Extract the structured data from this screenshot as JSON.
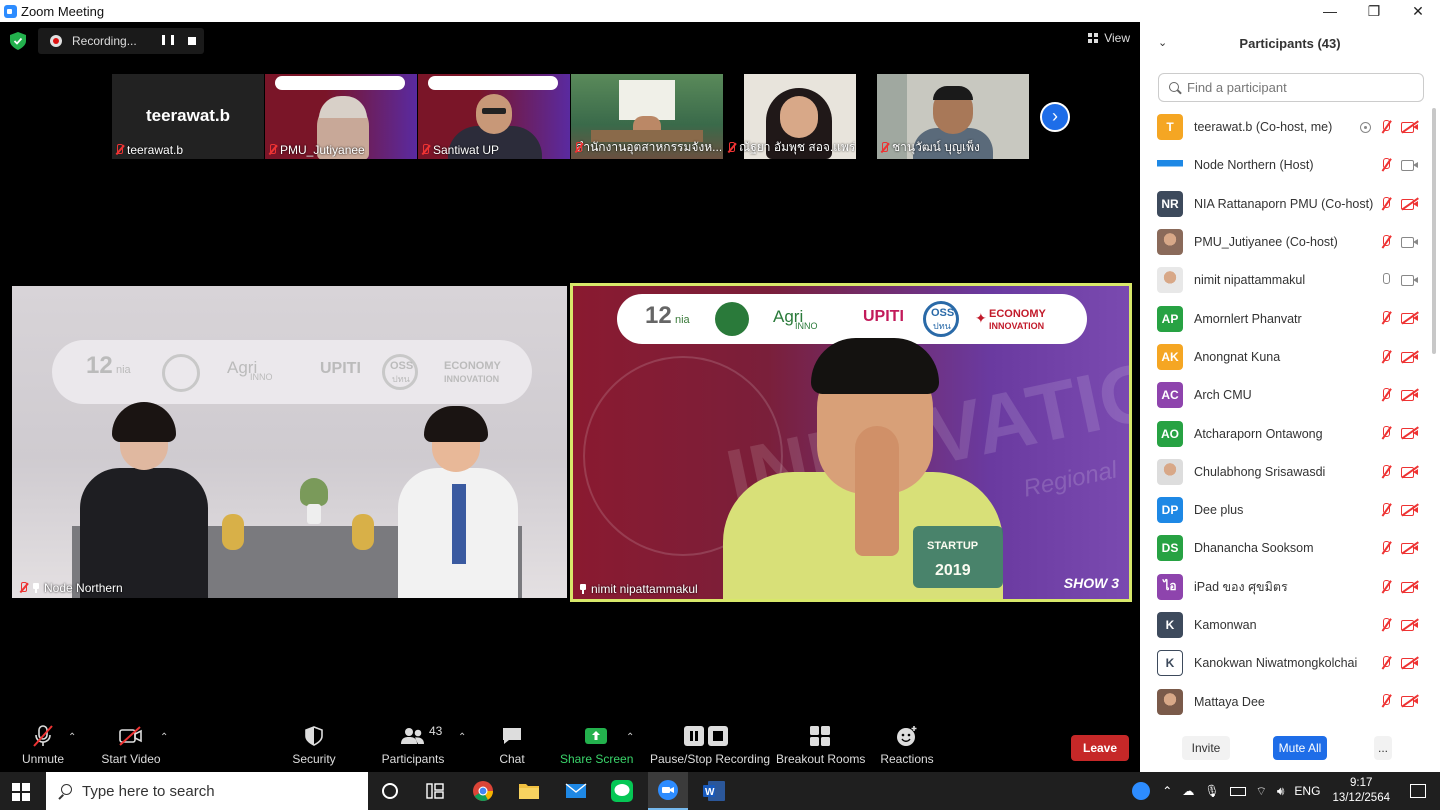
{
  "window": {
    "title": "Zoom Meeting",
    "controls": {
      "minimize": "—",
      "restore": "❐",
      "close": "✕"
    }
  },
  "topbar": {
    "recording_label": "Recording...",
    "view_label": "View"
  },
  "thumbnails": [
    {
      "name": "teerawat.b",
      "display_text": "teerawat.b",
      "muted": true,
      "has_video": false
    },
    {
      "name": "PMU_Jutiyanee",
      "muted": true,
      "has_video": true
    },
    {
      "name": "Santiwat UP",
      "muted": true,
      "has_video": true
    },
    {
      "name": "สำนักงานอุตสาหกรรมจังห...",
      "muted": true,
      "has_video": true
    },
    {
      "name": "ณัฐยา อัมพุช สอจ.แพร่",
      "muted": true,
      "has_video": true
    },
    {
      "name": "ชานุวัฒน์ บุญเพ็ง",
      "muted": true,
      "has_video": true
    }
  ],
  "main_videos": [
    {
      "name": "Node Northern",
      "muted": true,
      "pinned": true
    },
    {
      "name": "nimit nipattammakul",
      "muted": false,
      "pinned": true,
      "active_speaker": true
    }
  ],
  "video_banner_text": {
    "logo_12": "12",
    "nia": "nia",
    "agri": "Agri",
    "inno": "INNO",
    "upiti": "UPITI",
    "oss": "OSS",
    "oss_sub": "ปทน",
    "economy": "ECONOMY",
    "innovation": "INNOVATION",
    "show": "SHOW 3",
    "bg_word": "INNOVATION",
    "regional": "Regional",
    "shirt": "STARTUP",
    "shirt_year": "2019"
  },
  "toolbar": {
    "unmute": "Unmute",
    "start_video": "Start Video",
    "security": "Security",
    "participants": "Participants",
    "participants_count": "43",
    "chat": "Chat",
    "share_screen": "Share Screen",
    "pause_stop_recording": "Pause/Stop Recording",
    "breakout_rooms": "Breakout Rooms",
    "reactions": "Reactions",
    "leave": "Leave"
  },
  "panel": {
    "title": "Participants (43)",
    "search_placeholder": "Find a participant",
    "participants": [
      {
        "initials": "T",
        "color": "#f5a623",
        "name": "teerawat.b (Co-host, me)",
        "mic": "off",
        "cam": "off",
        "recording": true
      },
      {
        "initials": "",
        "color": "#ffffff",
        "name": "Node Northern (Host)",
        "mic": "off",
        "cam": "on",
        "avatar_type": "logo"
      },
      {
        "initials": "NR",
        "color": "#3d4a5c",
        "name": "NIA Rattanaporn PMU (Co-host)",
        "mic": "off",
        "cam": "off"
      },
      {
        "initials": "",
        "color": "#8a6a5a",
        "name": "PMU_Jutiyanee (Co-host)",
        "mic": "off",
        "cam": "on",
        "avatar_type": "photo"
      },
      {
        "initials": "",
        "color": "#e8e8e8",
        "name": "nimit nipattammakul",
        "mic": "on",
        "cam": "on",
        "avatar_type": "photo"
      },
      {
        "initials": "AP",
        "color": "#27a243",
        "name": "Amornlert Phanvatr",
        "mic": "off",
        "cam": "off"
      },
      {
        "initials": "AK",
        "color": "#f5a623",
        "name": "Anongnat Kuna",
        "mic": "off",
        "cam": "off"
      },
      {
        "initials": "AC",
        "color": "#8e44ad",
        "name": "Arch CMU",
        "mic": "off",
        "cam": "off"
      },
      {
        "initials": "AO",
        "color": "#27a243",
        "name": "Atcharaporn Ontawong",
        "mic": "off",
        "cam": "off"
      },
      {
        "initials": "",
        "color": "#dddddd",
        "name": "Chulabhong Srisawasdi",
        "mic": "off",
        "cam": "off",
        "avatar_type": "photo"
      },
      {
        "initials": "DP",
        "color": "#1e88e5",
        "name": "Dee plus",
        "mic": "off",
        "cam": "off"
      },
      {
        "initials": "DS",
        "color": "#27a243",
        "name": "Dhanancha Sooksom",
        "mic": "off",
        "cam": "off"
      },
      {
        "initials": "ไอ",
        "color": "#8e44ad",
        "name": "iPad ของ ศุขมิตร",
        "mic": "off",
        "cam": "off"
      },
      {
        "initials": "K",
        "color": "#3d4a5c",
        "name": "Kamonwan",
        "mic": "off",
        "cam": "off"
      },
      {
        "initials": "K",
        "color": "#3d4a5c",
        "name": "Kanokwan Niwatmongkolchai",
        "mic": "off",
        "cam": "off",
        "avatar_type": "outline"
      },
      {
        "initials": "",
        "color": "#7a5a4a",
        "name": "Mattaya Dee",
        "mic": "off",
        "cam": "off",
        "avatar_type": "photo"
      }
    ],
    "invite": "Invite",
    "mute_all": "Mute All",
    "more": "..."
  },
  "taskbar": {
    "search_placeholder": "Type here to search",
    "language": "ENG",
    "time": "9:17",
    "date": "13/12/2564",
    "apps": [
      "cortana-icon",
      "task-view-icon",
      "chrome-icon",
      "file-explorer-icon",
      "mail-icon",
      "line-icon",
      "zoom-icon",
      "word-icon"
    ]
  }
}
